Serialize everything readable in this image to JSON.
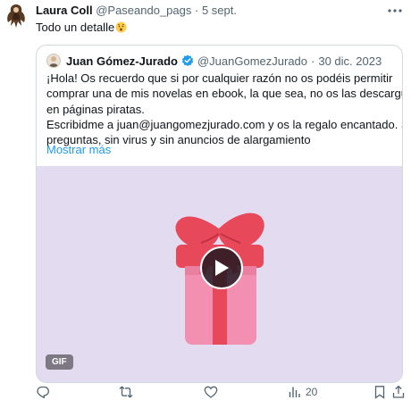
{
  "tweet": {
    "author_name": "Laura Coll",
    "author_handle": "@Paseando_pags",
    "separator": "·",
    "date": "5 sept.",
    "text": "Todo un detalle",
    "emoji_icon": "hushed-face-emoji"
  },
  "quoted": {
    "author_name": "Juan Gómez-Jurado",
    "author_handle": "@JuanGomezJurado",
    "separator": "·",
    "date": "30 dic. 2023",
    "body_lines": [
      "¡Hola! Os recuerdo que si por cualquier razón no os podéis permitir",
      "comprar una de mis novelas en ebook, la que sea, no os las descarguéis",
      "en páginas piratas.",
      "Escribidme a juan@juangomezjurado.com y os la regalo encantado. Sin",
      "preguntas, sin virus y sin anuncios de alargamiento"
    ],
    "show_more": "Mostrar más",
    "media": {
      "badge": "GIF",
      "description_icon": "gift-box-icon",
      "background": "#e3dbef"
    }
  },
  "actions": {
    "reply_count": "",
    "retweet_count": "",
    "like_count": "",
    "views_count": "20"
  },
  "colors": {
    "link": "#1d9bf0",
    "secondary_text": "#536471",
    "border": "#cfd9de",
    "verified": "#1d9bf0"
  }
}
